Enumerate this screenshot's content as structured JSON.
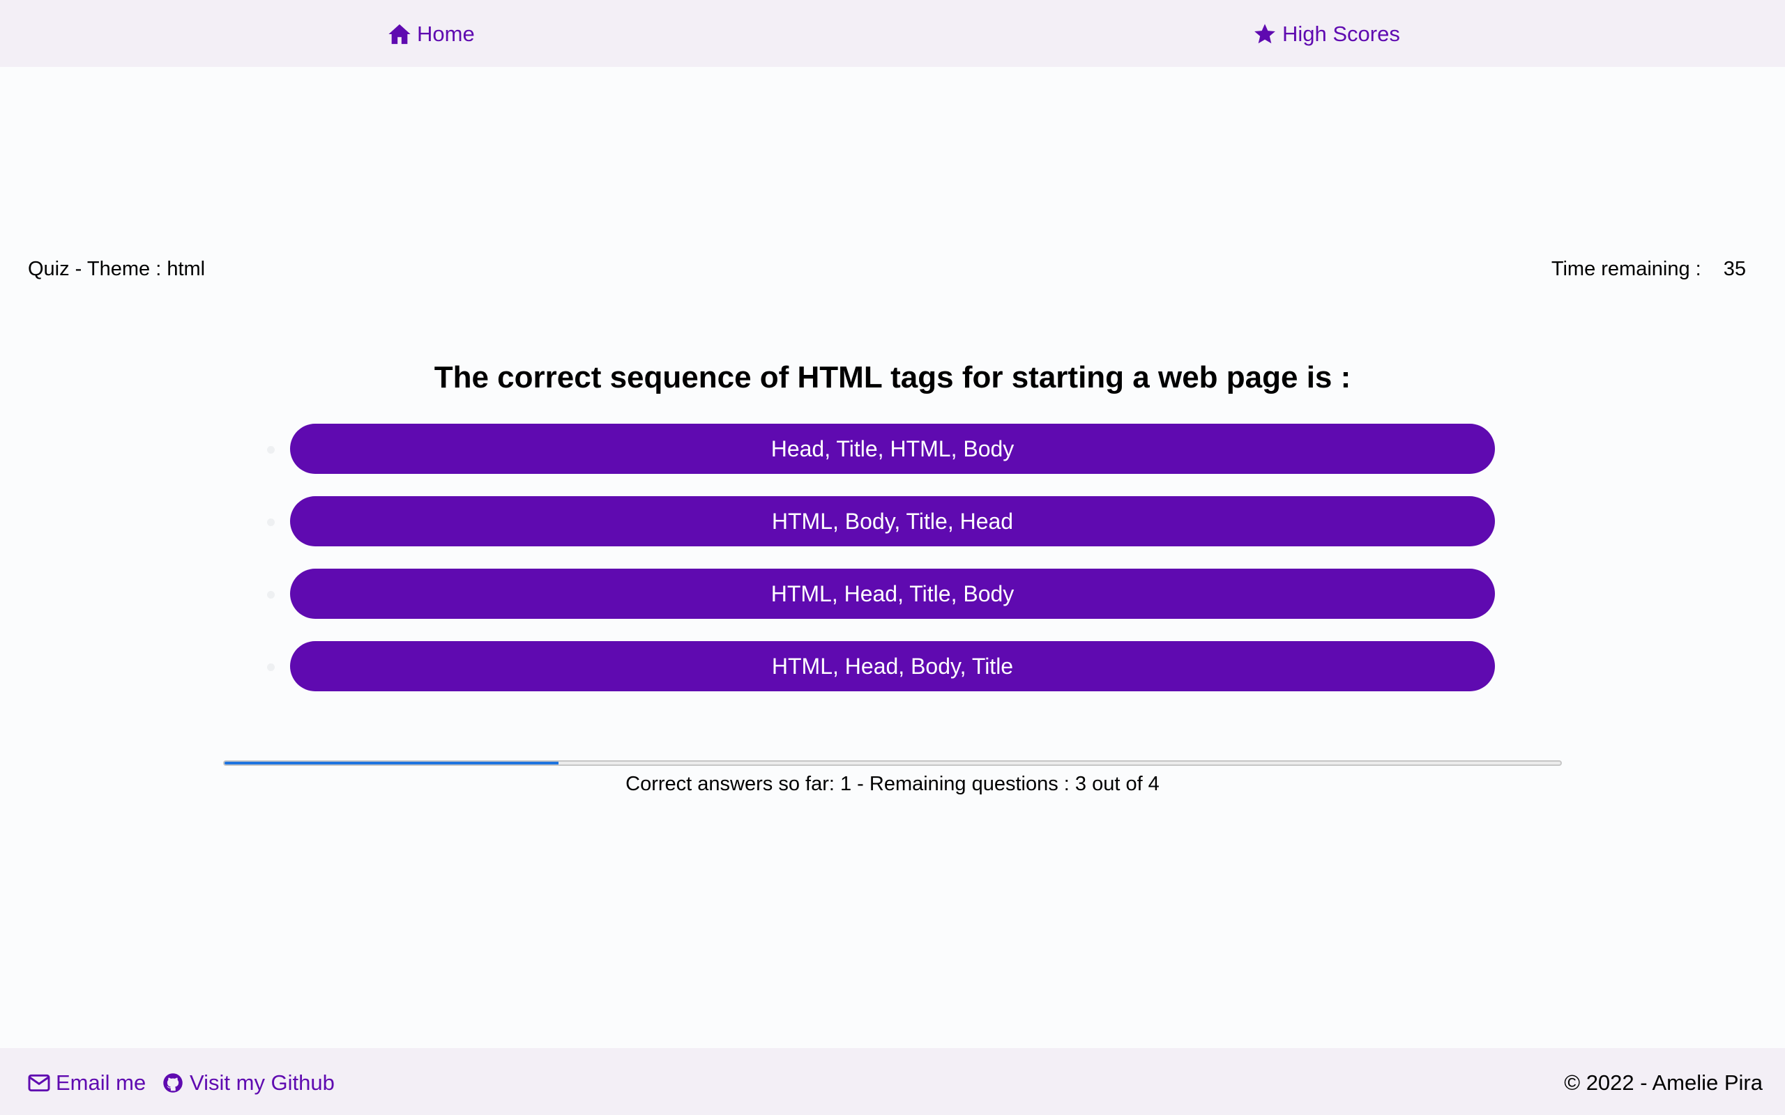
{
  "nav": {
    "home_label": "Home",
    "home_icon": "home-icon",
    "scores_label": "High Scores",
    "scores_icon": "star-icon"
  },
  "quiz": {
    "theme_prefix": "Quiz - Theme : ",
    "theme": "html",
    "timer_label": "Time remaining :",
    "timer_value": "35",
    "question": "The correct sequence of HTML tags for starting a web page is :",
    "answers": [
      {
        "label": "Head, Title, HTML, Body"
      },
      {
        "label": "HTML, Body, Title, Head"
      },
      {
        "label": "HTML, Head, Title, Body"
      },
      {
        "label": "HTML, Head, Body, Title"
      }
    ]
  },
  "progress": {
    "fraction": 0.25,
    "text": "Correct answers so far: 1 - Remaining questions : 3 out of 4"
  },
  "footer": {
    "email_label": "Email me",
    "email_icon": "envelope-icon",
    "github_label": "Visit my Github",
    "github_icon": "github-icon",
    "copyright": "© 2022 - Amelie Pira"
  },
  "colors": {
    "accent": "#5f0ab0",
    "bar_background": "#f3eff6",
    "progress_fill": "#1f74df",
    "page_background": "#fbfcfd"
  }
}
